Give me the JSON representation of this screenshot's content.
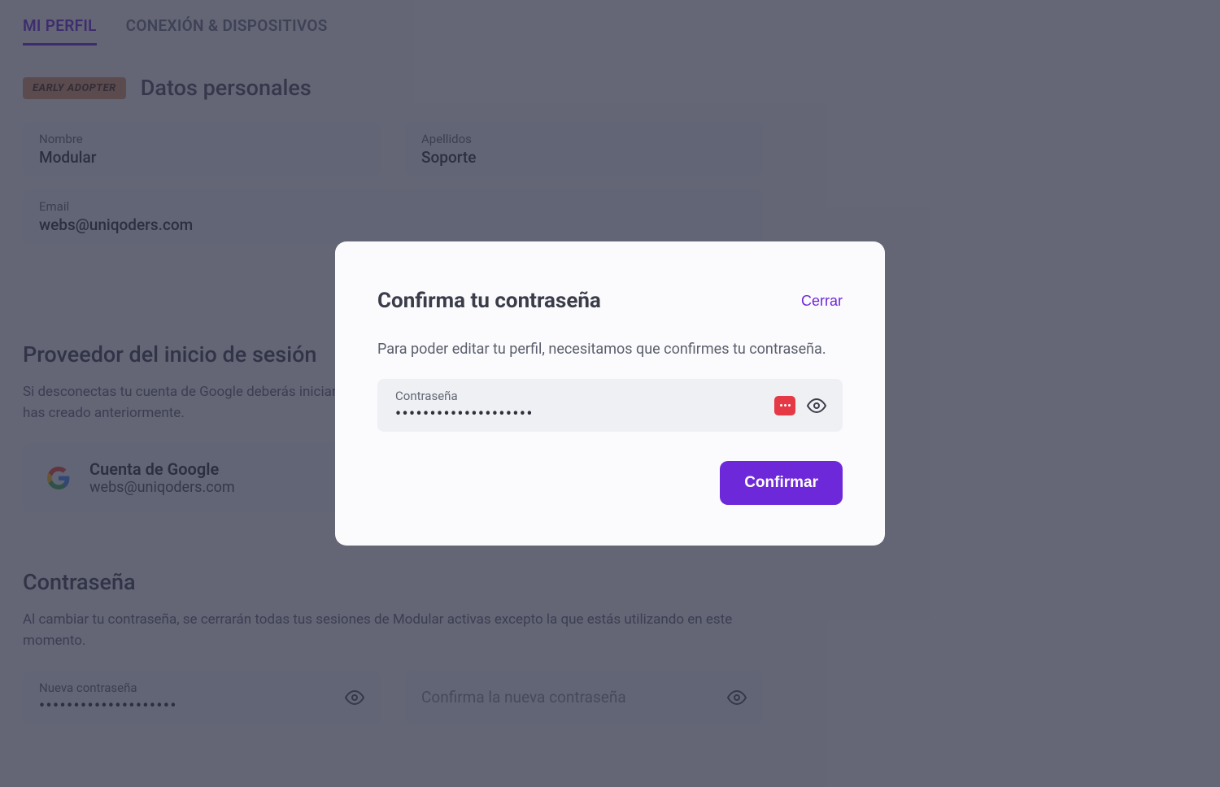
{
  "tabs": {
    "profile": "MI PERFIL",
    "connection": "CONEXIÓN & DISPOSITIVOS"
  },
  "badge": "EARLY ADOPTER",
  "personal": {
    "title": "Datos personales",
    "firstname_label": "Nombre",
    "firstname_value": "Modular",
    "lastname_label": "Apellidos",
    "lastname_value": "Soporte",
    "email_label": "Email",
    "email_value": "webs@uniqoders.com"
  },
  "provider": {
    "heading": "Proveedor del inicio de sesión",
    "desc": "Si desconectas tu cuenta de Google deberás iniciar sesión utilizando un Email y contraseña. Crea una contraseña si no la has creado anteriormente.",
    "card_title": "Cuenta de Google",
    "card_email": "webs@uniqoders.com"
  },
  "password": {
    "heading": "Contraseña",
    "desc": "Al cambiar tu contraseña, se cerrarán todas tus sesiones de Modular activas excepto la que estás utilizando en este momento.",
    "new_label": "Nueva contraseña",
    "new_value": "••••••••••••••••••••",
    "confirm_placeholder": "Confirma la nueva contraseña"
  },
  "modal": {
    "title": "Confirma tu contraseña",
    "close": "Cerrar",
    "desc": "Para poder editar tu perfil, necesitamos que confirmes tu contraseña.",
    "field_label": "Contraseña",
    "field_value": "••••••••••••••••••••",
    "confirm_button": "Confirmar"
  }
}
